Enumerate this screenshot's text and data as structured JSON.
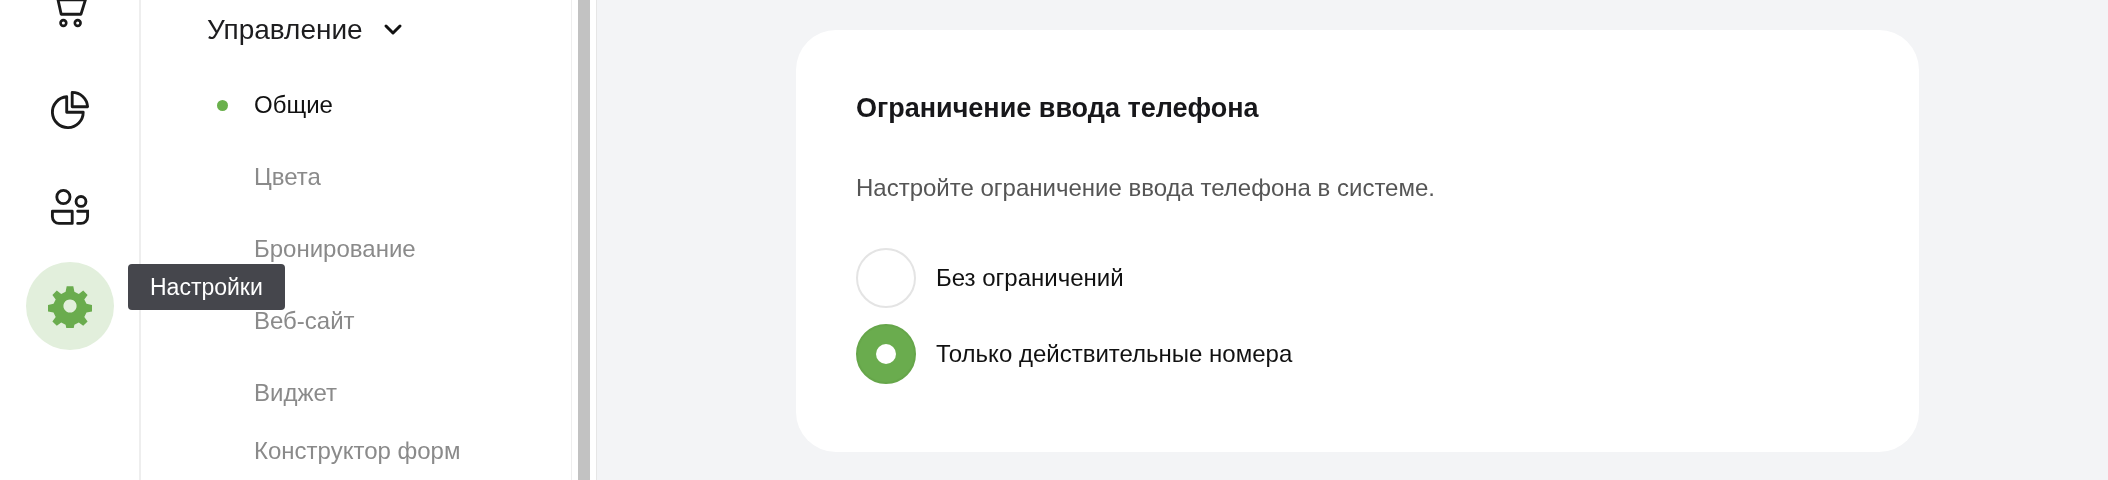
{
  "rail": [
    {
      "kind": "cart",
      "selected": false
    },
    {
      "kind": "chart",
      "selected": false
    },
    {
      "kind": "people",
      "selected": false
    },
    {
      "kind": "gear",
      "selected": true
    }
  ],
  "tooltip": "Настройки",
  "menu": {
    "title": "Управление",
    "expanded": true,
    "items": [
      {
        "label": "Общие",
        "selected": true
      },
      {
        "label": "Цвета",
        "selected": false
      },
      {
        "label": "Бронирование",
        "selected": false
      },
      {
        "label": "Веб-сайт",
        "selected": false
      },
      {
        "label": "Виджет",
        "selected": false
      },
      {
        "label": "Конструктор форм",
        "selected": false
      }
    ]
  },
  "card": {
    "title": "Ограничение ввода телефона",
    "description": "Настройте ограничение ввода телефона в системе.",
    "options": [
      {
        "label": "Без ограничений",
        "selected": false
      },
      {
        "label": "Только действительные номера",
        "selected": true
      }
    ]
  }
}
